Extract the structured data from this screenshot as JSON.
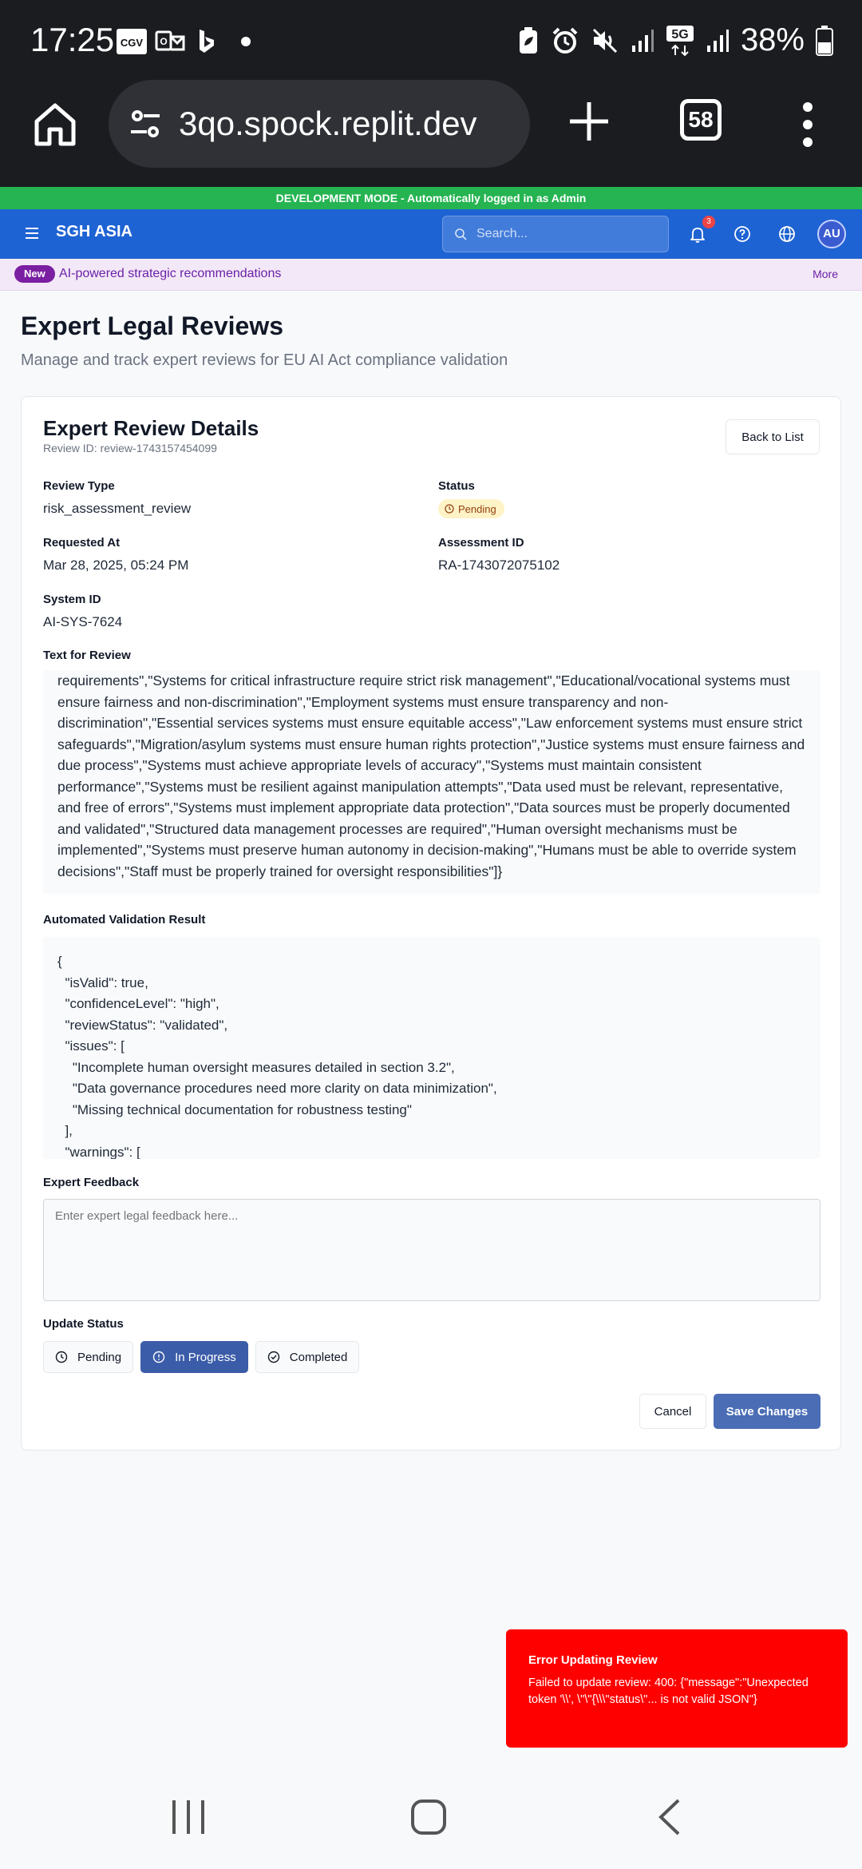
{
  "status_bar": {
    "time": "17:25",
    "battery": "38%",
    "network": "5G",
    "icons": [
      "cgv-app-icon",
      "outlook-icon",
      "bing-icon",
      "dot-icon",
      "battery-saver-icon",
      "alarm-icon",
      "mute-icon",
      "signal-icon",
      "5g-icon",
      "signal-icon",
      "battery-icon"
    ]
  },
  "browser": {
    "url": "3qo.spock.replit.dev",
    "tab_count": "58"
  },
  "dev_banner": "DEVELOPMENT MODE - Automatically logged in as Admin",
  "header": {
    "brand": "SGH ASIA",
    "search_placeholder": "Search...",
    "notification_count": "3",
    "avatar_initials": "AU"
  },
  "announcement": {
    "badge": "New",
    "text": "AI-powered strategic recommendations",
    "more": "More"
  },
  "page": {
    "title": "Expert Legal Reviews",
    "subtitle": "Manage and track expert reviews for EU AI Act compliance validation"
  },
  "card": {
    "title": "Expert Review Details",
    "review_id": "Review ID: review-1743157454099",
    "back_label": "Back to List",
    "fields": {
      "review_type_label": "Review Type",
      "review_type": "risk_assessment_review",
      "status_label": "Status",
      "status": "Pending",
      "requested_at_label": "Requested At",
      "requested_at": "Mar 28, 2025, 05:24 PM",
      "assessment_id_label": "Assessment ID",
      "assessment_id": "RA-1743072075102",
      "system_id_label": "System ID",
      "system_id": "AI-SYS-7624"
    },
    "text_for_review_label": "Text for Review",
    "text_for_review": "requirements\",\"Systems for critical infrastructure require strict risk management\",\"Educational/vocational systems must ensure fairness and non-discrimination\",\"Employment systems must ensure transparency and non-discrimination\",\"Essential services systems must ensure equitable access\",\"Law enforcement systems must ensure strict safeguards\",\"Migration/asylum systems must ensure human rights protection\",\"Justice systems must ensure fairness and due process\",\"Systems must achieve appropriate levels of accuracy\",\"Systems must maintain consistent performance\",\"Systems must be resilient against manipulation attempts\",\"Data used must be relevant, representative, and free of errors\",\"Systems must implement appropriate data protection\",\"Data sources must be properly documented and validated\",\"Structured data management processes are required\",\"Human oversight mechanisms must be implemented\",\"Systems must preserve human autonomy in decision-making\",\"Humans must be able to override system decisions\",\"Staff must be properly trained for oversight responsibilities\"]}",
    "validation_label": "Automated Validation Result",
    "validation_json": "{\n  \"isValid\": true,\n  \"confidenceLevel\": \"high\",\n  \"reviewStatus\": \"validated\",\n  \"issues\": [\n    \"Incomplete human oversight measures detailed in section 3.2\",\n    \"Data governance procedures need more clarity on data minimization\",\n    \"Missing technical documentation for robustness testing\"\n  ],\n  \"warnings\": [",
    "feedback_label": "Expert Feedback",
    "feedback_placeholder": "Enter expert legal feedback here...",
    "update_status_label": "Update Status",
    "status_options": [
      "Pending",
      "In Progress",
      "Completed"
    ],
    "cancel_label": "Cancel",
    "save_label": "Save Changes"
  },
  "toast": {
    "title": "Error Updating Review",
    "message": "Failed to update review: 400: {\"message\":\"Unexpected token '\\\\', \\\"\\\"{\\\\\\\"status\\\"... is not valid JSON\"}"
  },
  "colors": {
    "dev_banner": "#25b451",
    "app_header": "#1e63d3",
    "primary_button": "#4a6db5",
    "active_status": "#3b5ca8",
    "toast": "#ff0000",
    "pending_badge": "#fef3c7"
  }
}
